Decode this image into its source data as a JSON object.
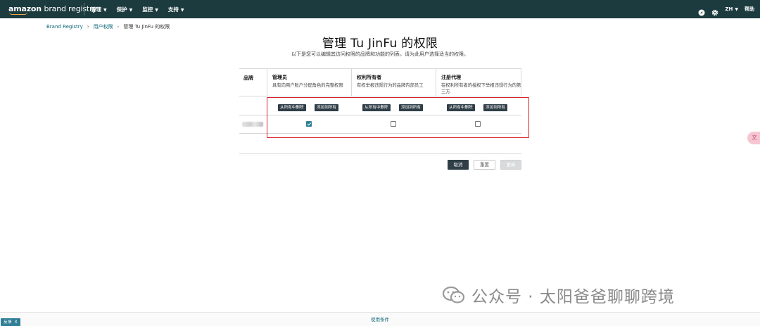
{
  "app": {
    "logo_main": "amazon",
    "logo_brand": "brand registry"
  },
  "nav": {
    "items": [
      {
        "label": "管理"
      },
      {
        "label": "保护"
      },
      {
        "label": "监控"
      },
      {
        "label": "支持"
      }
    ],
    "language": "ZH",
    "help": "帮助",
    "icons": [
      "compass-icon",
      "gear-icon",
      "chevron-down-icon"
    ]
  },
  "breadcrumb": {
    "items": [
      "Brand Registry",
      "用户权限",
      "管理 Tu JinFu 的权限"
    ]
  },
  "page": {
    "title": "管理 Tu JinFu 的权限",
    "subtitle": "以下是您可以编辑其访问权限的品牌和功能的列表。请为此用户选择适当的权限。"
  },
  "table": {
    "brand_header": "品牌",
    "columns": [
      {
        "title": "管理员",
        "desc": "具有向用户账户分配角色的完整权限",
        "remove": "从所有中删除",
        "add": "添加到所有",
        "checked": true
      },
      {
        "title": "权利所有者",
        "desc": "有权举报违规行为的品牌内部员工",
        "remove": "从所有中删除",
        "add": "添加到所有",
        "checked": false
      },
      {
        "title": "注册代理",
        "desc": "在权利所有者的授权下举报违规行为的第三方",
        "remove": "从所有中删除",
        "add": "添加到所有",
        "checked": false
      }
    ]
  },
  "actions": {
    "cancel": "取消",
    "reset": "重置",
    "update": "更新"
  },
  "side_widget": "文",
  "watermark": "公众号 · 太阳爸爸聊聊跨境",
  "footer": {
    "terms": "使用条件",
    "feedback": "反馈",
    "feedback_close": "X"
  },
  "colors": {
    "topbar": "#1c3b3f",
    "accent": "#2f7e96",
    "highlight": "#d9232a",
    "dark_button": "#2f3e47"
  }
}
